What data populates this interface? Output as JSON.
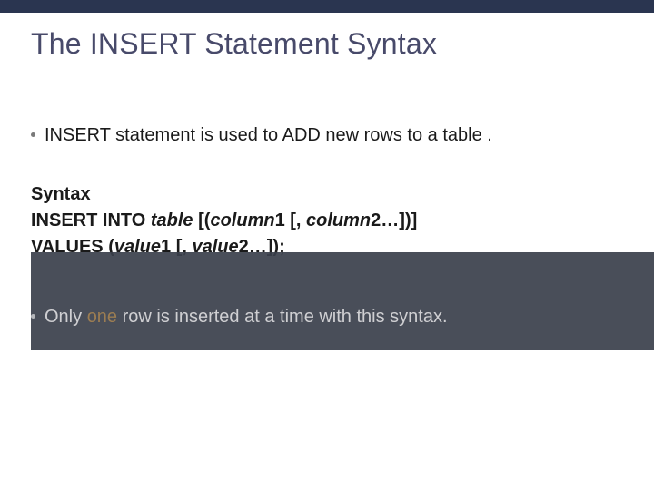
{
  "title": "The INSERT Statement Syntax",
  "bullets": {
    "intro_prefix": "INSERT statement",
    "intro_rest": " is used to ADD new rows to a table .",
    "note_prefix": "Only ",
    "note_keyword": "one",
    "note_rest": " row is inserted at a time with this syntax."
  },
  "syntax": {
    "heading": "Syntax",
    "l1_a": "INSERT INTO ",
    "l1_b": "table ",
    "l1_c": "[(",
    "l1_d": "column",
    "l1_e": "1 [, ",
    "l1_f": "column",
    "l1_g": "2…])]",
    "l2_a": "VALUES (",
    "l2_b": "value",
    "l2_c": "1 [, ",
    "l2_d": "value",
    "l2_e": "2…]);"
  }
}
